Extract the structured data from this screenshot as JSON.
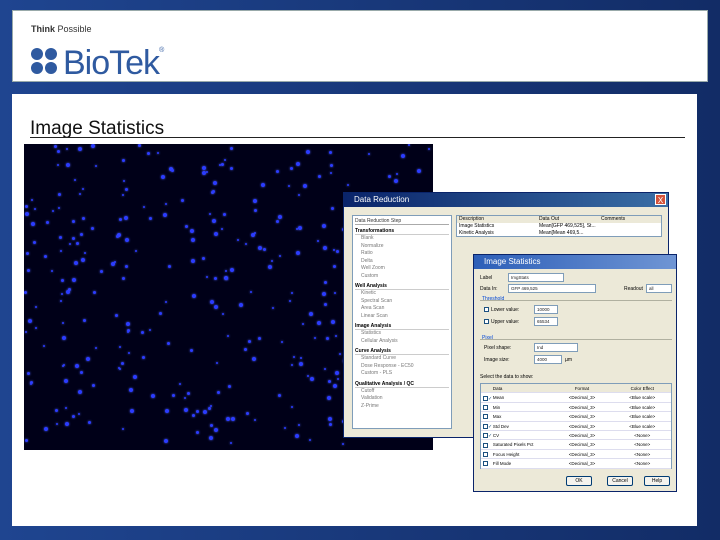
{
  "header": {
    "tagline_bold": "Think",
    "tagline_rest": "Possible",
    "brand": "BioTek",
    "brand_mark": "®"
  },
  "slide": {
    "title": "Image Statistics"
  },
  "data_reduction": {
    "title": "Data Reduction",
    "close": "X",
    "steps_header": "Data Reduction Step",
    "sections": [
      {
        "label": "Transformations",
        "items": [
          "Blank",
          "Normalize",
          "Ratio",
          "Delta",
          "Well Zoom",
          "Custom"
        ]
      },
      {
        "label": "Well Analysis",
        "items": [
          "Kinetic",
          "Spectral Scan",
          "Area Scan",
          "Linear Scan"
        ]
      },
      {
        "label": "Image Analysis",
        "items": [
          "Statistics",
          "Cellular Analysis"
        ]
      },
      {
        "label": "Curve Analysis",
        "items": [
          "Standard Curve",
          "Dose Response - EC50",
          "Custom - PLS"
        ]
      },
      {
        "label": "Qualitative Analysis / QC",
        "items": [
          "Cutoff",
          "Validation",
          "Z-Prime"
        ]
      }
    ],
    "table_headers": [
      "Description",
      "Data Out",
      "Comments"
    ],
    "table_rows": [
      [
        "Image Statistics",
        "Mean[GFP 469,525], St...",
        ""
      ],
      [
        "Kinetic Analysis",
        "Mean[Mean 469,5...",
        ""
      ]
    ]
  },
  "image_statistics": {
    "title": "Image Statistics",
    "label_caption": "Label",
    "label_value": "ImgStats",
    "data_in_caption": "Data In:",
    "data_in_value": "GFP 469,525",
    "readout_caption": "Readout",
    "readout_value": "all",
    "threshold_label": "Threshold",
    "lower_label": "Lower value:",
    "lower_value": "10000",
    "upper_label": "Upper value:",
    "upper_value": "65534",
    "pixel_label": "Pixel",
    "pixel_shape_label": "Pixel shape:",
    "pixel_shape_value": "Ind",
    "image_size_label": "Image size:",
    "image_size_value": "4000",
    "image_size_unit": "µm",
    "select_label": "Select the data to show:",
    "columns": [
      "Data",
      "Format",
      "Color Effect"
    ],
    "rows": [
      {
        "checked": true,
        "data": "Mean",
        "format": "<Decimal_3>",
        "color": "<Blue scale>"
      },
      {
        "checked": false,
        "data": "Min",
        "format": "<Decimal_3>",
        "color": "<Blue scale>"
      },
      {
        "checked": false,
        "data": "Max",
        "format": "<Decimal_3>",
        "color": "<Blue scale>"
      },
      {
        "checked": true,
        "data": "Std Dev",
        "format": "<Decimal_3>",
        "color": "<Blue scale>"
      },
      {
        "checked": true,
        "data": "CV",
        "format": "<Decimal_3>",
        "color": "<None>"
      },
      {
        "checked": false,
        "data": "Saturated Pixels Pct",
        "format": "<Decimal_3>",
        "color": "<None>"
      },
      {
        "checked": false,
        "data": "Focus Height",
        "format": "<Decimal_3>",
        "color": "<None>"
      },
      {
        "checked": false,
        "data": "Fill Mode",
        "format": "<Decimal_3>",
        "color": "<None>"
      }
    ],
    "buttons": {
      "ok": "OK",
      "cancel": "Cancel",
      "help": "Help"
    }
  },
  "colors": {
    "slide_bg": "#1f4590",
    "brand": "#2f5aa0",
    "titlebar": "#0a246a",
    "cells": "#2b3cff"
  }
}
